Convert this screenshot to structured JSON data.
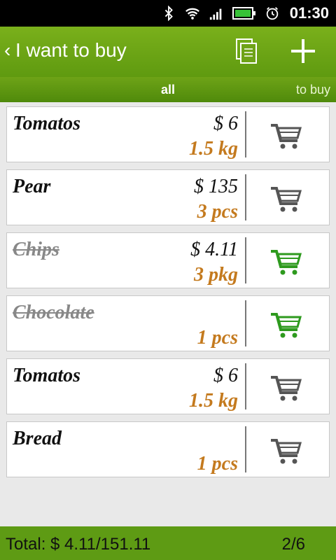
{
  "statusbar": {
    "time": "01:30",
    "icons": [
      "bluetooth-icon",
      "wifi-icon",
      "signal-icon",
      "battery-icon",
      "alarm-icon"
    ]
  },
  "appbar": {
    "back_glyph": "‹",
    "title": "I want to buy",
    "actions": [
      "copy-icon",
      "plus-icon"
    ]
  },
  "tabs": {
    "all": "all",
    "to_buy": "to buy"
  },
  "items": [
    {
      "name": "Tomatos",
      "price": "$ 6",
      "qty": "1.5 kg",
      "bought": false
    },
    {
      "name": "Pear",
      "price": "$ 135",
      "qty": "3 pcs",
      "bought": false
    },
    {
      "name": "Chips",
      "price": "$ 4.11",
      "qty": "3 pkg",
      "bought": true
    },
    {
      "name": "Chocolate",
      "price": "",
      "qty": "1 pcs",
      "bought": true
    },
    {
      "name": "Tomatos",
      "price": "$ 6",
      "qty": "1.5 kg",
      "bought": false
    },
    {
      "name": "Bread",
      "price": "",
      "qty": "1 pcs",
      "bought": false
    }
  ],
  "footer": {
    "total": "Total: $ 4.11/151.11",
    "page": "2/6"
  },
  "colors": {
    "brand_green": "#6ea317",
    "qty_orange": "#c47a1e",
    "cart_active": "#2e9a1e",
    "cart_inactive": "#555555"
  }
}
